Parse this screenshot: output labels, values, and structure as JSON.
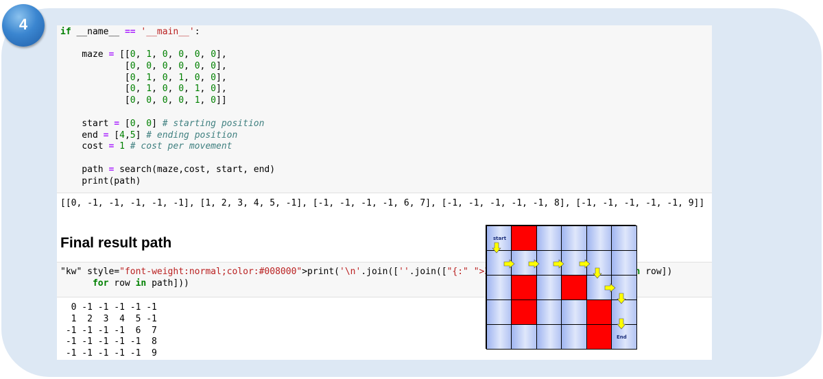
{
  "badge": {
    "number": "4"
  },
  "code_cell": {
    "lines": [
      "    maze = [[0, 1, 0, 0, 0, 0],",
      "            [0, 0, 0, 0, 0, 0],",
      "            [0, 1, 0, 1, 0, 0],",
      "            [0, 1, 0, 0, 1, 0],",
      "            [0, 0, 0, 0, 1, 0]]",
      "",
      "    start = [0, 0] # starting position",
      "    end = [4,5] # ending position",
      "    cost = 1 # cost per movement",
      "",
      "    path = search(maze,cost, start, end)",
      "    print(path)"
    ],
    "first_line": {
      "kw_if": "if",
      "name": " __name__ ",
      "op": "==",
      "str": " '__main__'",
      "colon": ":"
    }
  },
  "output1": "[[0, -1, -1, -1, -1, -1], [1, 2, 3, 4, 5, -1], [-1, -1, -1, -1, 6, 7], [-1, -1, -1, -1, -1, 8], [-1, -1, -1, -1, -1, 9]]",
  "heading": "Final result path",
  "code_cell2": {
    "line1": "print('\\n'.join([''.join([\"{:\" \">3d}\".format(item) for item in row])",
    "line2": "      for row in path]))"
  },
  "output2": [
    "  0 -1 -1 -1 -1 -1",
    "  1  2  3  4  5 -1",
    " -1 -1 -1 -1  6  7",
    " -1 -1 -1 -1 -1  8",
    " -1 -1 -1 -1 -1  9"
  ],
  "maze_diagram": {
    "start_label": "start",
    "end_label": "End",
    "walls": [
      [
        0,
        1
      ],
      [
        2,
        1
      ],
      [
        2,
        3
      ],
      [
        3,
        1
      ],
      [
        3,
        4
      ],
      [
        4,
        4
      ]
    ],
    "arrow_color": "#ffff00",
    "wall_color": "#ff0000"
  }
}
